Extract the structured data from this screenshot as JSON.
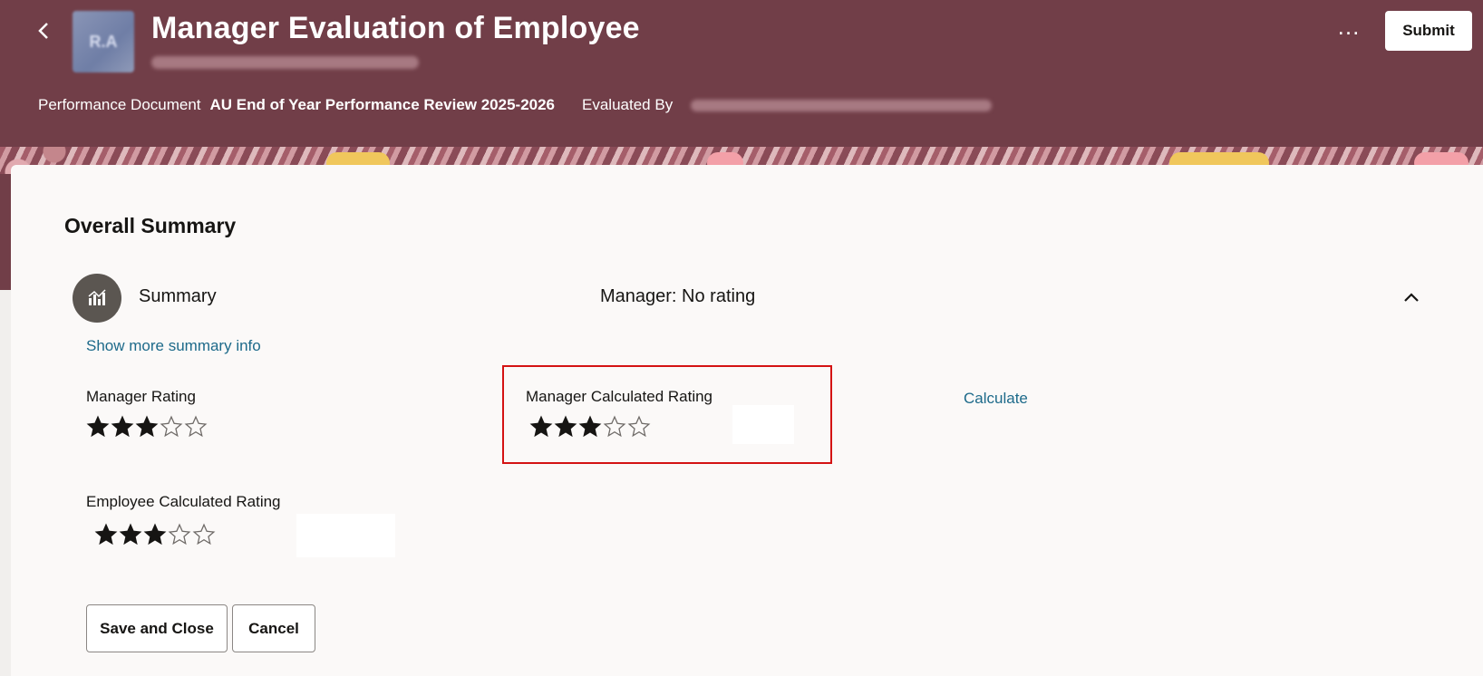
{
  "header": {
    "title": "Manager Evaluation of Employee",
    "avatar_initials": "R.A",
    "more_label": "…",
    "submit_label": "Submit",
    "performance_document_label": "Performance Document",
    "performance_document_value": "AU End of Year Performance Review 2025-2026",
    "evaluated_by_label": "Evaluated By",
    "colors": {
      "band": "#713e48",
      "accent": "#f0c75c"
    }
  },
  "summary": {
    "section_title": "Overall Summary",
    "row_label": "Summary",
    "manager_status": "Manager: No rating",
    "show_more_link": "Show more summary info",
    "manager_rating": {
      "label": "Manager Rating",
      "stars_filled": 3,
      "stars_total": 5
    },
    "manager_calculated_rating": {
      "label": "Manager Calculated Rating",
      "stars_filled": 3,
      "stars_total": 5
    },
    "calculate_link": "Calculate",
    "employee_calculated_rating": {
      "label": "Employee Calculated Rating",
      "stars_filled": 3,
      "stars_total": 5
    },
    "link_color": "#1d6a8a",
    "highlight_color": "#d41313"
  },
  "actions": {
    "save_close_label": "Save and Close",
    "cancel_label": "Cancel"
  }
}
